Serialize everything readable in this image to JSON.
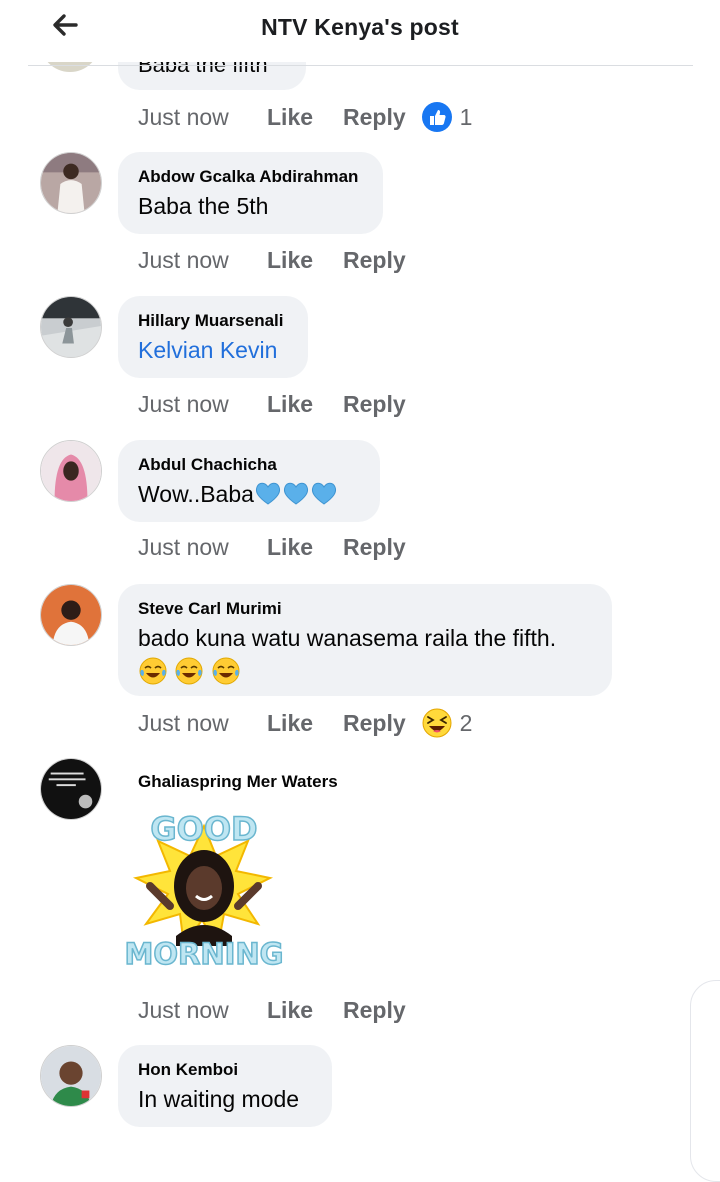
{
  "header": {
    "title": "NTV Kenya's post"
  },
  "clipped_comment": {
    "text": "Baba the fifth",
    "time": "Just now",
    "like": "Like",
    "reply": "Reply",
    "reaction": {
      "type": "like",
      "count": "1"
    }
  },
  "comments": [
    {
      "name": "Abdow Gcalka Abdirahman",
      "text": "Baba the 5th",
      "time": "Just now",
      "like": "Like",
      "reply": "Reply"
    },
    {
      "name": "Hillary Muarsenali",
      "text": "Kelvian Kevin",
      "time": "Just now",
      "like": "Like",
      "reply": "Reply"
    },
    {
      "name": "Abdul Chachicha",
      "text": "Wow..Baba",
      "time": "Just now",
      "like": "Like",
      "reply": "Reply"
    },
    {
      "name": "Steve Carl Murimi",
      "text": "bado kuna watu wanasema raila the fifth.",
      "time": "Just now",
      "like": "Like",
      "reply": "Reply",
      "reaction": {
        "type": "haha",
        "count": "2"
      }
    },
    {
      "name": "Ghaliaspring Mer Waters",
      "sticker_text_top": "GOOD",
      "sticker_text_bottom": "MORNING",
      "time": "Just now",
      "like": "Like",
      "reply": "Reply"
    },
    {
      "name": "Hon Kemboi",
      "text": "In waiting mode"
    }
  ],
  "colors": {
    "bubble": "#f0f2f5",
    "link": "#216fdb",
    "meta": "#65676b",
    "like_blue": "#1877f2"
  },
  "icons": [
    "back-arrow-icon",
    "like-reaction-icon",
    "blue-heart-icon",
    "tears-of-joy-icon",
    "haha-reaction-icon"
  ]
}
